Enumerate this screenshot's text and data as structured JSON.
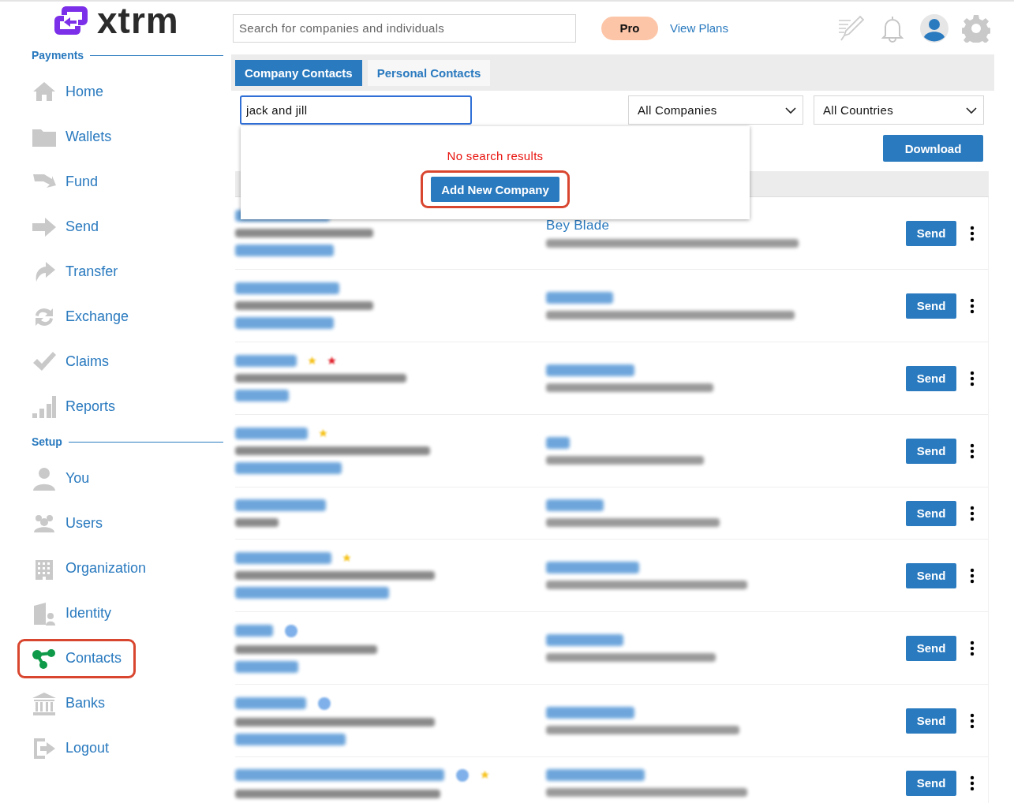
{
  "logo": {
    "text": "xtrm"
  },
  "sidebar": {
    "sections": [
      {
        "title": "Payments",
        "items": [
          {
            "label": "Home",
            "selected": false,
            "highlighted": false
          },
          {
            "label": "Wallets",
            "selected": false,
            "highlighted": false
          },
          {
            "label": "Fund",
            "selected": false,
            "highlighted": false
          },
          {
            "label": "Send",
            "selected": false,
            "highlighted": false
          },
          {
            "label": "Transfer",
            "selected": false,
            "highlighted": false
          },
          {
            "label": "Exchange",
            "selected": false,
            "highlighted": false
          },
          {
            "label": "Claims",
            "selected": false,
            "highlighted": false
          },
          {
            "label": "Reports",
            "selected": false,
            "highlighted": false
          }
        ]
      },
      {
        "title": "Setup",
        "items": [
          {
            "label": "You",
            "selected": false,
            "highlighted": false
          },
          {
            "label": "Users",
            "selected": false,
            "highlighted": false
          },
          {
            "label": "Organization",
            "selected": false,
            "highlighted": false
          },
          {
            "label": "Identity",
            "selected": false,
            "highlighted": false
          },
          {
            "label": "Contacts",
            "selected": true,
            "highlighted": true
          },
          {
            "label": "Banks",
            "selected": false,
            "highlighted": false
          },
          {
            "label": "Logout",
            "selected": false,
            "highlighted": false
          }
        ]
      }
    ]
  },
  "topbar": {
    "search": {
      "placeholder": "Search for companies and individuals"
    },
    "plan_badge": "Pro",
    "plans_link": "View Plans"
  },
  "tabs": [
    {
      "label": "Company Contacts",
      "selected": true
    },
    {
      "label": "Personal Contacts",
      "selected": false
    }
  ],
  "filters": {
    "search_value": "jack and jill",
    "company_filter": "All Companies",
    "country_filter": "All Countries"
  },
  "download_button": "Download",
  "search_popup": {
    "message": "No search results",
    "action": "Add New Company",
    "action_highlighted": true
  },
  "rows": [
    {
      "contact_name": "Bey Blade",
      "action": "Send"
    },
    {
      "action": "Send"
    },
    {
      "action": "Send"
    },
    {
      "action": "Send"
    },
    {
      "action": "Send"
    },
    {
      "action": "Send"
    },
    {
      "action": "Send"
    },
    {
      "action": "Send"
    },
    {
      "action": "Send"
    }
  ]
}
